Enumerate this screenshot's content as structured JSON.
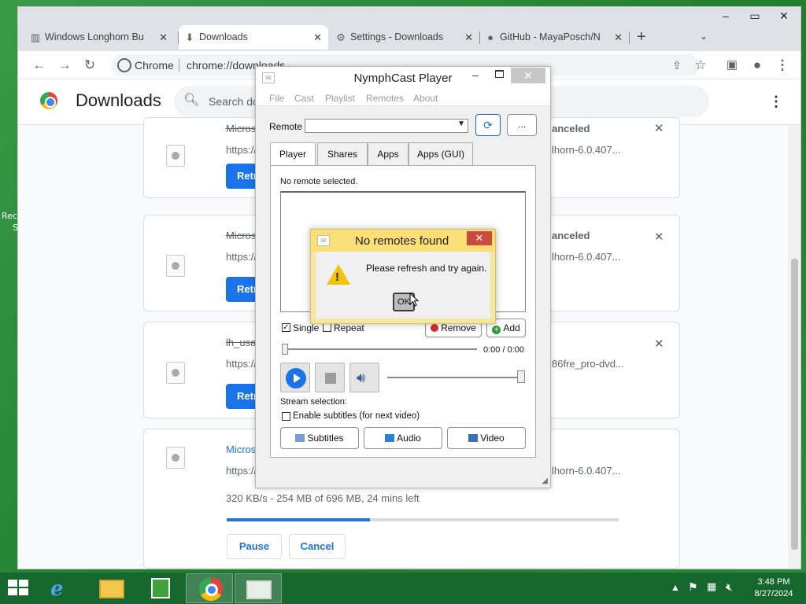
{
  "desktop": {
    "left_label_1": "Rec",
    "left_label_2": "S"
  },
  "browser": {
    "tabs": [
      {
        "label": "Windows Longhorn Bu",
        "icon": "library-icon"
      },
      {
        "label": "Downloads",
        "icon": "download-icon"
      },
      {
        "label": "Settings - Downloads",
        "icon": "gear-icon"
      },
      {
        "label": "GitHub - MayaPosch/N",
        "icon": "github-icon"
      }
    ],
    "new_tab": "+",
    "omnibox_site": "Chrome",
    "omnibox_url": "chrome://downloads",
    "page_title": "Downloads",
    "search_placeholder": "Search do",
    "downloads": [
      {
        "name": "Micros",
        "url": "https://",
        "url_right": "lhorn-6.0.407...",
        "status": "anceled",
        "retry": "Retr"
      },
      {
        "name": "Micros",
        "url": "https://",
        "url_right": "lhorn-6.0.407...",
        "status": "anceled",
        "retry": "Retr"
      },
      {
        "name": "lh_usa",
        "url": "https://",
        "url_right": "86fre_pro-dvd...",
        "status": "",
        "retry": "Retr"
      },
      {
        "name": "Micros",
        "url": "https://",
        "url_right": "lhorn-6.0.407...",
        "status": "",
        "progress_text": "320 KB/s - 254 MB of 696 MB, 24 mins left",
        "progress": 0.365,
        "pause": "Pause",
        "cancel": "Cancel"
      }
    ]
  },
  "nymphcast": {
    "title": "NymphCast Player",
    "menu": [
      "File",
      "Cast",
      "Playlist",
      "Remotes",
      "About"
    ],
    "remote_label": "Remote",
    "remote_value": "",
    "refresh_glyph": "⟳",
    "more_label": "...",
    "tabs": [
      "Player",
      "Shares",
      "Apps",
      "Apps (GUI)"
    ],
    "no_remote": "No remote selected.",
    "single_label": "Single",
    "single_checked": true,
    "repeat_label": "Repeat",
    "repeat_checked": false,
    "remove_label": "Remove",
    "add_label": "Add",
    "time": "0:00 / 0:00",
    "stream_selection": "Stream selection:",
    "subtitles_checkbox": "Enable subtitles (for next video)",
    "subtitles_btn": "Subtitles",
    "audio_btn": "Audio",
    "video_btn": "Video",
    "seek_fraction": 0.0,
    "volume_fraction": 1.0
  },
  "dialog": {
    "title": "No remotes found",
    "message": "Please refresh and try again.",
    "ok": "OK"
  },
  "taskbar": {
    "clock_time": "3:48 PM",
    "clock_date": "8/27/2024"
  }
}
